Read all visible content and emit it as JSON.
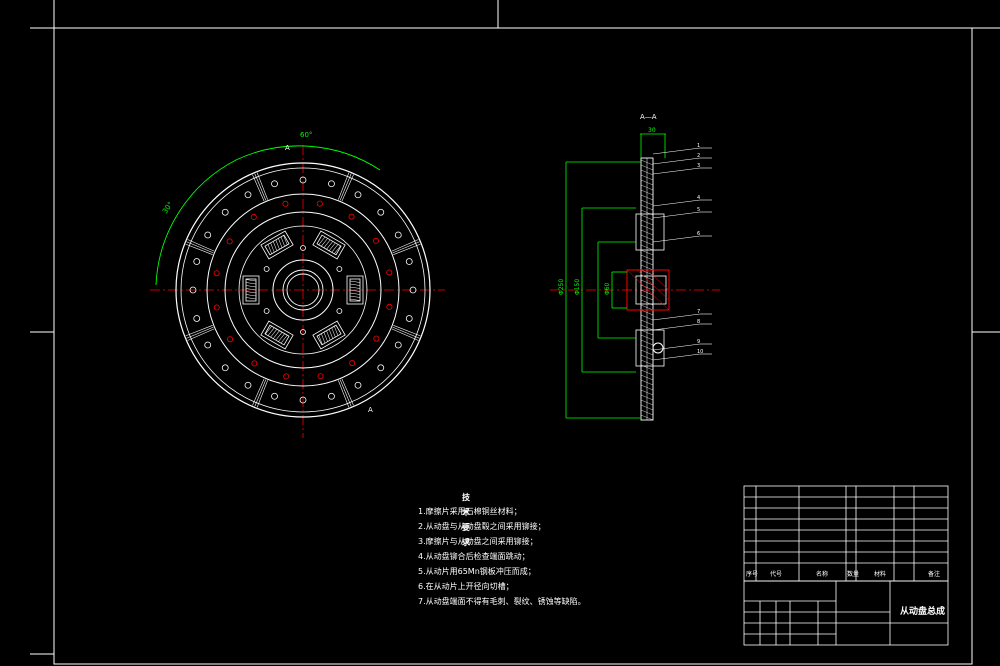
{
  "section_label": "A—A",
  "section_marks": {
    "top": "A",
    "bottom": "A"
  },
  "dims": {
    "angle_top": "60°",
    "angle_left": "30°",
    "width_top": "30",
    "d_outer": "Φ250",
    "d_mid": "Φ150",
    "d_hub": "Φ60"
  },
  "balloons": [
    "1",
    "2",
    "3",
    "4",
    "5",
    "6",
    "7",
    "8",
    "9",
    "10"
  ],
  "notes_title": "技术要求",
  "notes": [
    "1.摩擦片采用石棉铜丝材料；",
    "2.从动盘与从动盘毂之间采用铆接；",
    "3.摩擦片与从动盘之间采用铆接；",
    "4.从动盘铆合后检查端面跳动；",
    "5.从动片用65Mn钢板冲压而成；",
    "6.在从动片上开径向切槽；",
    "7.从动盘端面不得有毛刺、裂纹、锈蚀等缺陷。"
  ],
  "table_header": {
    "col1": "序号",
    "col2": "代号",
    "col3": "名称",
    "col4": "数量",
    "col5": "材料",
    "col6": "备注"
  },
  "title_block": {
    "name": "从动盘总成"
  },
  "colors": {
    "line": "#ffffff",
    "red": "#ff0000",
    "green": "#00ff00",
    "cyan": "#00ffff",
    "frame": "#ffffff"
  }
}
